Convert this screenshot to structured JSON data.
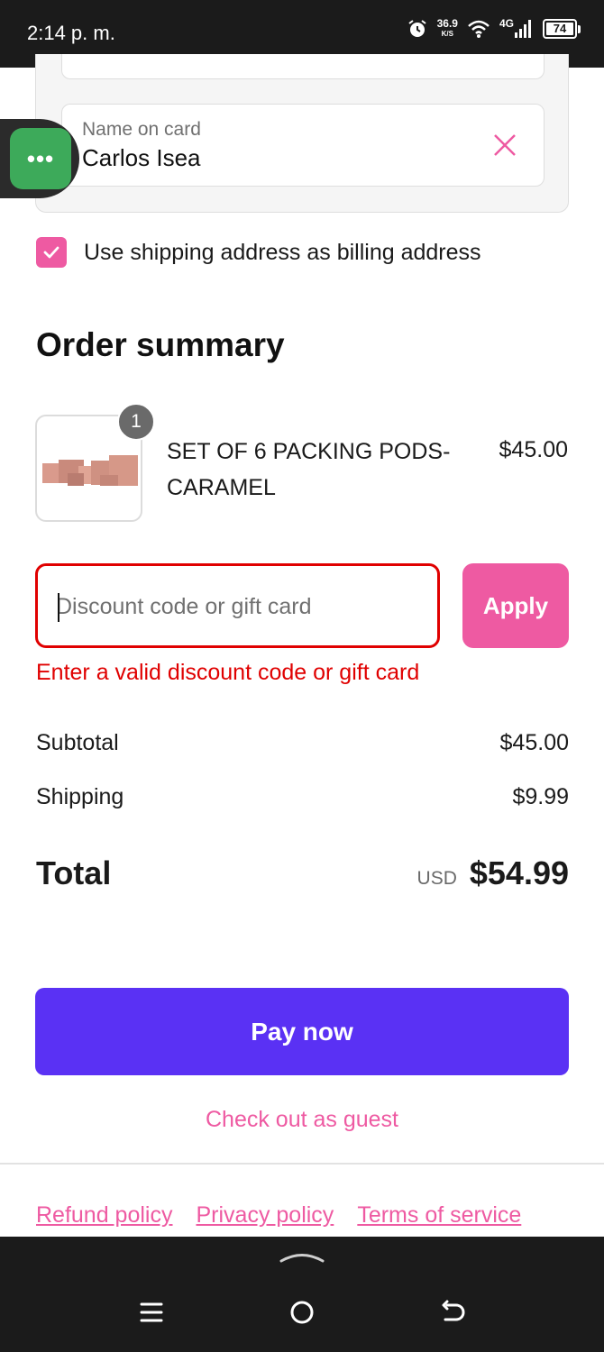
{
  "status_bar": {
    "time": "2:14 p. m.",
    "speed_value": "36.9",
    "speed_unit": "K/S",
    "network": "4G",
    "battery": "74"
  },
  "card_form": {
    "name_label": "Name on card",
    "name_value": "Carlos Isea"
  },
  "billing_checkbox": {
    "label": "Use shipping address as billing address",
    "checked": true
  },
  "order_summary": {
    "title": "Order summary",
    "item": {
      "name": "SET OF 6 PACKING PODS-CARAMEL",
      "price": "$45.00",
      "quantity": "1"
    }
  },
  "discount": {
    "placeholder": "Discount code or gift card",
    "apply_label": "Apply",
    "error": "Enter a valid discount code or gift card"
  },
  "totals": {
    "subtotal_label": "Subtotal",
    "subtotal_value": "$45.00",
    "shipping_label": "Shipping",
    "shipping_value": "$9.99",
    "total_label": "Total",
    "currency": "USD",
    "total_value": "$54.99"
  },
  "actions": {
    "pay_label": "Pay now",
    "guest_label": "Check out as guest"
  },
  "footer": {
    "links": [
      "Refund policy",
      "Privacy policy",
      "Terms of service"
    ]
  },
  "colors": {
    "accent": "#ee5aa2",
    "pay_button": "#5a31f4",
    "error": "#e00000"
  }
}
